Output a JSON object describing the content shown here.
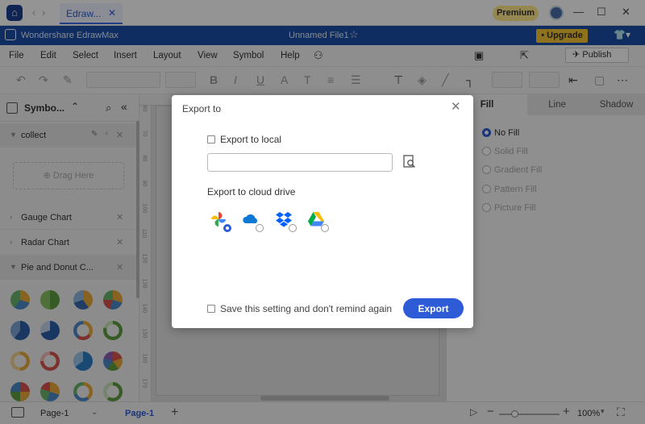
{
  "titlebar": {
    "tab_label": "Edraw...",
    "tab_close": "✕",
    "premium": "Premium",
    "back": "‹",
    "forward": "›",
    "minimize": "—",
    "maximize": "☐",
    "close": "✕"
  },
  "appbar": {
    "app_name": "Wondershare EdrawMax",
    "file_name": "Unnamed File1",
    "upgrade": "• Upgrade"
  },
  "menu": {
    "items": [
      "File",
      "Edit",
      "Select",
      "Insert",
      "Layout",
      "View",
      "Symbol",
      "Help"
    ],
    "publish": "Publish"
  },
  "leftpanel": {
    "header": "Symbo...",
    "collect": "collect",
    "drag_here": "Drag Here",
    "libraries": [
      "Gauge Chart",
      "Radar Chart",
      "Pie and Donut C..."
    ]
  },
  "ruler": {
    "marks": [
      "60",
      "70",
      "80",
      "90",
      "100",
      "110",
      "120",
      "130",
      "140",
      "150",
      "160",
      "170"
    ]
  },
  "rightpanel": {
    "tabs": [
      "Fill",
      "Line",
      "Shadow"
    ],
    "fill_options": [
      "No Fill",
      "Solid Fill",
      "Gradient Fill",
      "Pattern Fill",
      "Picture Fill"
    ]
  },
  "statusbar": {
    "page_select": "Page-1",
    "page_tab": "Page-1",
    "zoom": "100%"
  },
  "dialog": {
    "title": "Export to",
    "export_local_label": "Export to local",
    "path_value": "",
    "cloud_label": "Export to cloud drive",
    "cloud_services": [
      "google-photos",
      "onedrive",
      "dropbox",
      "google-drive"
    ],
    "save_setting_label": "Save this setting and don't remind again",
    "export_button": "Export"
  },
  "colors": {
    "accent": "#2d5cd6",
    "appbar": "#1b4ea6",
    "premium": "#ffe98a",
    "upgrade": "#f5c534"
  }
}
